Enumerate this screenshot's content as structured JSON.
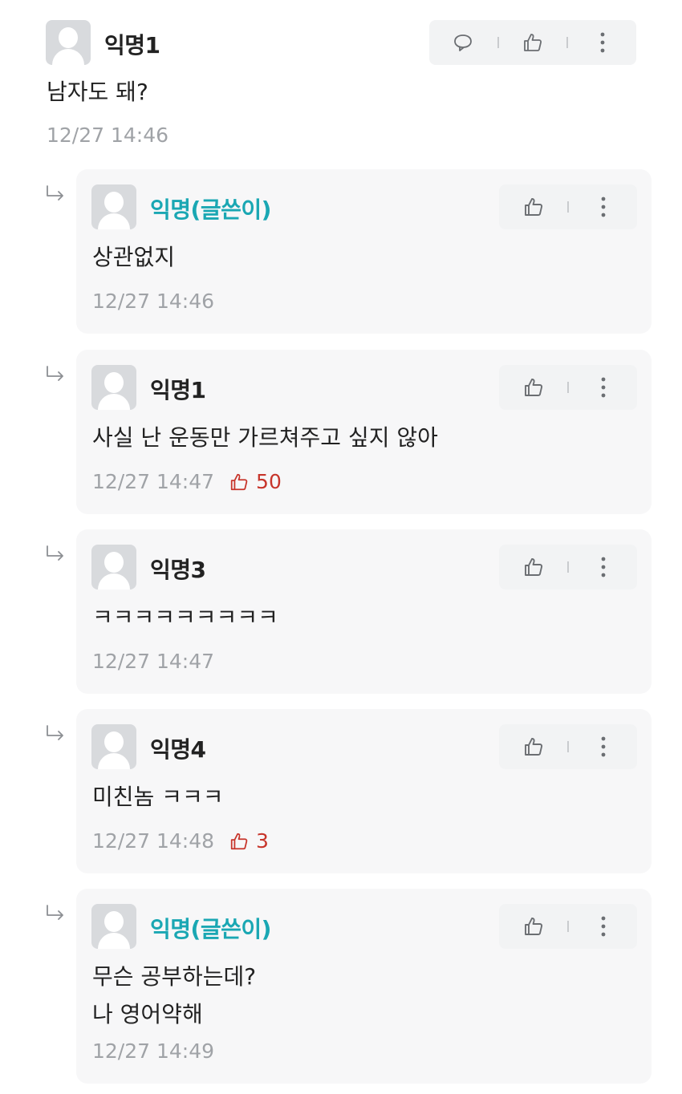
{
  "top_comment": {
    "author": "익명1",
    "content": "남자도 돼?",
    "time": "12/27 14:46"
  },
  "replies": [
    {
      "author": "익명(글쓴이)",
      "is_op": true,
      "content": "상관없지",
      "time": "12/27 14:46",
      "likes": null
    },
    {
      "author": "익명1",
      "is_op": false,
      "content": "사실 난 운동만 가르쳐주고 싶지 않아",
      "time": "12/27 14:47",
      "likes": "50"
    },
    {
      "author": "익명3",
      "is_op": false,
      "content": "ㅋㅋㅋㅋㅋㅋㅋㅋㅋ",
      "time": "12/27 14:47",
      "likes": null
    },
    {
      "author": "익명4",
      "is_op": false,
      "content": "미친놈 ㅋㅋㅋ",
      "time": "12/27 14:48",
      "likes": "3"
    },
    {
      "author": "익명(글쓴이)",
      "is_op": true,
      "content": "무슨 공부하는데?\n나 영어약해",
      "time": "12/27 14:49",
      "likes": null
    }
  ],
  "icons": {
    "reply": "speech-bubble-icon",
    "like": "thumbs-up-icon",
    "more": "vertical-dots-icon",
    "reply_indicator": "reply-arrow-icon"
  },
  "colors": {
    "op_author": "#1aa7b3",
    "like_count": "#c7352b",
    "meta_text": "#a0a3a7",
    "reply_bg": "#f7f7f8",
    "action_bg": "#f2f3f4"
  }
}
